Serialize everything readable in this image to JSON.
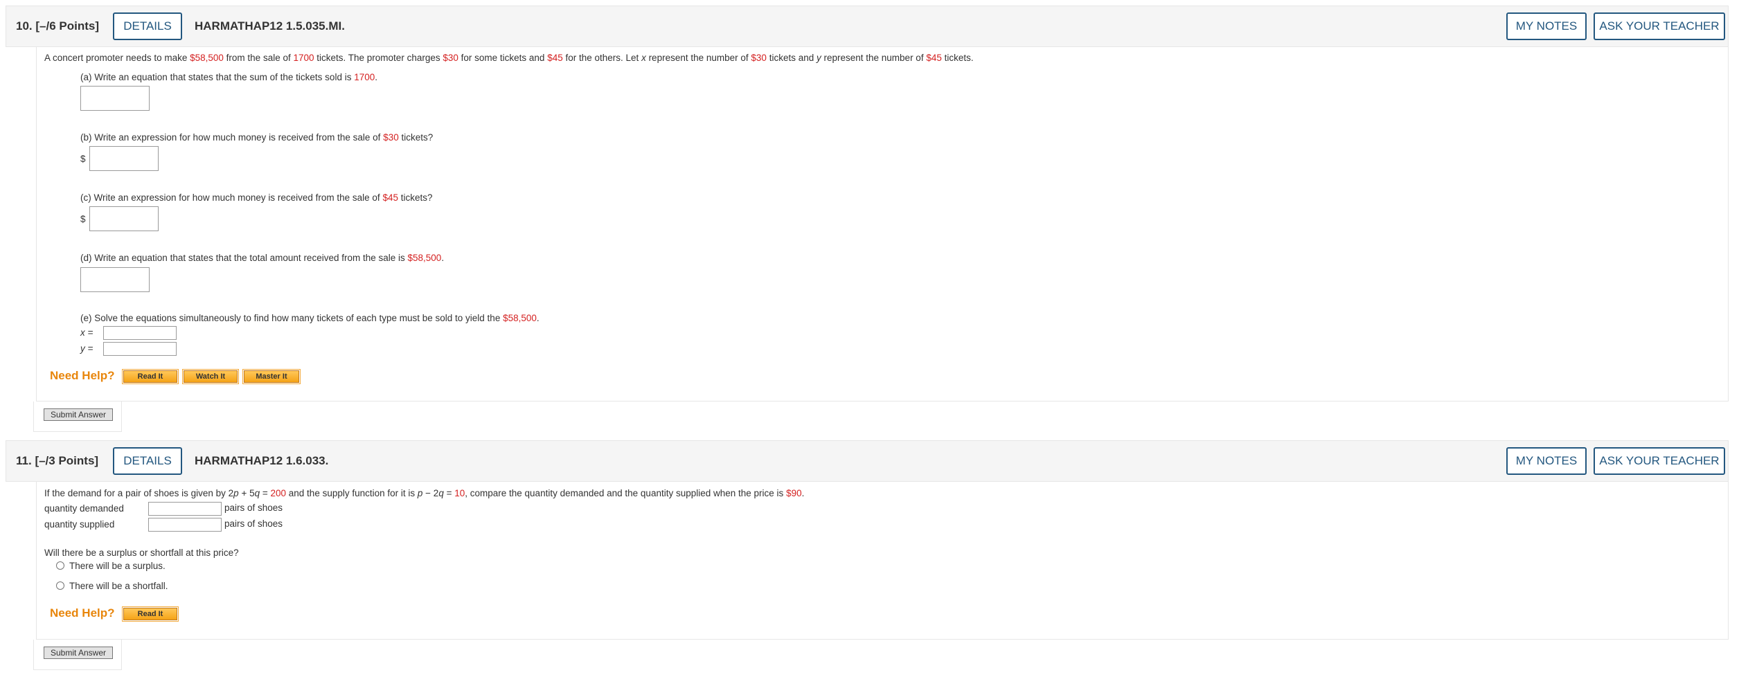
{
  "questions": [
    {
      "number": "10.",
      "points": "[–/6 Points]",
      "details_label": "DETAILS",
      "code": "HARMATHAP12 1.5.035.MI.",
      "my_notes_label": "MY NOTES",
      "ask_teacher_label": "ASK YOUR TEACHER",
      "prompt": {
        "p1": "A concert promoter needs to make ",
        "v1": "$58,500",
        "p2": " from the sale of ",
        "v2": "1700",
        "p3": " tickets. The promoter charges ",
        "v3": "$30",
        "p4": " for some tickets and ",
        "v4": "$45",
        "p5": " for the others. Let ",
        "x": "x",
        "p6": " represent the number of ",
        "v5": "$30",
        "p7": " tickets and ",
        "y": "y",
        "p8": " represent the number of ",
        "v6": "$45",
        "p9": " tickets."
      },
      "parts": {
        "a": {
          "text": "(a) Write an equation that states that the sum of the tickets sold is ",
          "value": "1700",
          "end": "."
        },
        "b": {
          "text": "(b) Write an expression for how much money is received from the sale of ",
          "value": "$30",
          "end": " tickets?",
          "prefix": "$"
        },
        "c": {
          "text": "(c) Write an expression for how much money is received from the sale of ",
          "value": "$45",
          "end": " tickets?",
          "prefix": "$"
        },
        "d": {
          "text": "(d) Write an equation that states that the total amount received from the sale is ",
          "value": "$58,500",
          "end": "."
        },
        "e": {
          "text": "(e) Solve the equations simultaneously to find how many tickets of each type must be sold to yield the ",
          "value": "$58,500",
          "end": ".",
          "x_label": "x =",
          "y_label": "y ="
        }
      },
      "need_help": "Need Help?",
      "help_buttons": [
        "Read It",
        "Watch It",
        "Master It"
      ],
      "submit_label": "Submit Answer"
    },
    {
      "number": "11.",
      "points": "[–/3 Points]",
      "details_label": "DETAILS",
      "code": "HARMATHAP12 1.6.033.",
      "my_notes_label": "MY NOTES",
      "ask_teacher_label": "ASK YOUR TEACHER",
      "prompt": {
        "p1": "If the demand for a pair of shoes is given by 2",
        "pvar": "p",
        "p2": " + 5",
        "qvar": "q",
        "p3": " = ",
        "v1": "200",
        "p4": " and the supply function for it is ",
        "pvar2": "p",
        "p5": " − 2",
        "qvar2": "q",
        "p6": " = ",
        "v2": "10",
        "p7": ", compare the quantity demanded and the quantity supplied when the price is ",
        "v3": "$90",
        "p8": "."
      },
      "rows": [
        {
          "label": "quantity demanded",
          "unit": "pairs of shoes"
        },
        {
          "label": "quantity supplied",
          "unit": "pairs of shoes"
        }
      ],
      "surplus_question": "Will there be a surplus or shortfall at this price?",
      "options": [
        "There will be a surplus.",
        "There will be a shortfall."
      ],
      "need_help": "Need Help?",
      "help_buttons": [
        "Read It"
      ],
      "submit_label": "Submit Answer"
    }
  ]
}
